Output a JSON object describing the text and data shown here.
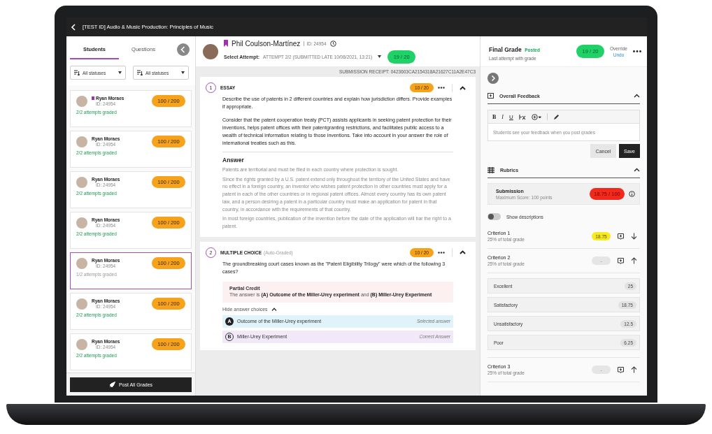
{
  "window": {
    "title": "[TEST ID]  Audio & Music Production: Principles of Music"
  },
  "students_panel": {
    "tabs": [
      {
        "label": "Students",
        "selected": true
      },
      {
        "label": "Questions",
        "selected": false
      }
    ],
    "filters": [
      "All statuses",
      "All statuses"
    ],
    "students": [
      {
        "name": "Ryan Moraes",
        "id": "ID: 24954",
        "status": "2/2 attempts graded",
        "complete": true,
        "grade": "100 / 200",
        "flagged": true,
        "selected": false
      },
      {
        "name": "Ryan Moraes",
        "id": "ID: 24954",
        "status": "2/2 attempts graded",
        "complete": true,
        "grade": "100 / 200",
        "flagged": false,
        "selected": false
      },
      {
        "name": "Ryan Moraes",
        "id": "ID: 24954",
        "status": "2/2 attempts graded",
        "complete": true,
        "grade": "100 / 200",
        "flagged": false,
        "selected": false
      },
      {
        "name": "Ryan Moraes",
        "id": "ID: 24954",
        "status": "2/2 attempts graded",
        "complete": true,
        "grade": "100 / 200",
        "flagged": false,
        "selected": false
      },
      {
        "name": "Ryan Moraes",
        "id": "ID: 24954",
        "status": "1/2 attempts graded",
        "complete": false,
        "grade": "100 / 200",
        "flagged": false,
        "selected": true
      },
      {
        "name": "Ryan Moraes",
        "id": "ID: 24954",
        "status": "2/2 attempts graded",
        "complete": true,
        "grade": "100 / 200",
        "flagged": false,
        "selected": false
      },
      {
        "name": "Ryan Moraes",
        "id": "ID: 24954",
        "status": "2/2 attempts graded",
        "complete": true,
        "grade": "100 / 200",
        "flagged": false,
        "selected": false
      }
    ],
    "post_button": "Post All Grades"
  },
  "submission": {
    "student": "Phil Coulson-Martínez",
    "flagged": true,
    "id": "ID: 24954",
    "attempt_label": "Select Attempt:",
    "attempt": "ATTEMPT 2/2 (SUBMITTED LATE 10/08/2021, 13:21)",
    "grade": "19 / 20",
    "receipt": "SUBMISSION RECEIPT: 0423603CA2154318A21627C11A2E47C3",
    "questions": [
      {
        "kind": "essay",
        "number": "1",
        "type": "ESSAY",
        "score": "10 / 20",
        "expanded": true,
        "prompt": [
          "Describe the use of patents in 2 different countries and explain how jurisdiction differs. Provide examples if appropriate.",
          "Consider that the patent cooperation treaty (PCT) assists applicants in seeking patent protection for their inventions, helps patent offices with their patentgranting restrictions, and facilitates public access to a wealth of technical information relating to those inventions. Take into account in your answer the role of international treaties such as this."
        ],
        "answer_heading": "Answer",
        "answer": [
          "Patents are territorial and must be filed in each country where protection is sought.",
          "Since the rights granted by a U.S. patent extend only throughout the territory of the United States and have no effect in a foreign country, an inventor who wishes patent protection in other countries must apply for a patent in each of the other countries or in regional patent offices. Almost every country has its own patent law, and a person desiring a patent in a particular country must make an application for patent in that country, in accordance with the requirements of that country.",
          "In most foreign countries, publication of the invention before the date of the application will bar the right to a patent."
        ]
      },
      {
        "kind": "multiple_choice",
        "number": "2",
        "type": "MULTIPLE CHOICE",
        "note": "(Auto-Graded)",
        "score": "10 / 20",
        "expanded": true,
        "prompt": [
          "The groundbreaking court cases known as the \"Patent Eligibility Trilogy\" were which of the following 3 cases?"
        ],
        "result_title": "Partial Credit",
        "result_text": "The answer is **(A) Outcome of the Miller-Urey experiment** and **(B) Miller-Urey Experiment**",
        "choices_toggle": "Hide answer choices",
        "choices": [
          {
            "letter": "A",
            "text": "Outcome of the Miller-Urey experiment",
            "tag": "Selected answer",
            "kind": "selected"
          },
          {
            "letter": "B",
            "text": "Miller-Urey Experiment",
            "tag": "Correct Answer",
            "kind": "correct"
          }
        ]
      }
    ]
  },
  "grading": {
    "title": "Final Grade",
    "state": "Posted",
    "subtitle": "Last attempt with grade",
    "grade": "19 / 20",
    "override": "Override",
    "undo": "Undo",
    "feedback": {
      "title": "Overall Feedback",
      "expanded": true,
      "format_buttons": [
        "B",
        "I",
        "U"
      ],
      "placeholder": "Students see your feedback when you post grades",
      "cancel": "Cancel",
      "save": "Save"
    },
    "rubrics": {
      "title": "Rubrics",
      "expanded": true,
      "submission_title": "Submission",
      "submission_max": "Maximum Score: 100 points",
      "submission_score": "18.75 / 100",
      "show_descriptions": {
        "label": "Show descriptions",
        "on": false
      },
      "criteria": [
        {
          "name": "Criterion 1",
          "weight": "25% of total grade",
          "score": "18.75",
          "graded": true,
          "expanded": false
        },
        {
          "name": "Criterion 2",
          "weight": "25% of total grade",
          "score": "-",
          "graded": false,
          "expanded": true,
          "levels": [
            {
              "label": "Excellent",
              "points": "25"
            },
            {
              "label": "Satisfactory",
              "points": "18.75"
            },
            {
              "label": "Unsatisfactory",
              "points": "12.5"
            },
            {
              "label": "Poor",
              "points": "6.25"
            }
          ]
        },
        {
          "name": "Criterion 3",
          "weight": "25% of total grade",
          "score": "-",
          "graded": false,
          "expanded": true
        }
      ]
    }
  }
}
